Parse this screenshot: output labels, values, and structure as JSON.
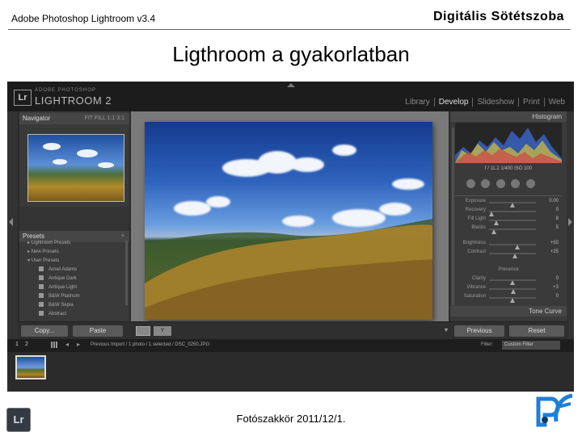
{
  "slide": {
    "header_left": "Adobe Photoshop Lightroom v3.4",
    "header_right": "Digitális Sötétszoba",
    "title": "Ligthroom a gyakorlatban",
    "footer": "Fotószakkör 2011/12/1.",
    "badge": "Lr",
    "logo_icon": "camera-club-logo-icon"
  },
  "lightroom": {
    "logo_mark": "Lr",
    "product_top": "ADOBE PHOTOSHOP",
    "product_name": "LIGHTROOM 2",
    "modules": [
      "Library",
      "Develop",
      "Slideshow",
      "Print",
      "Web"
    ],
    "active_module": "Develop",
    "left_panel": {
      "navigator": "Navigator",
      "navigator_options": "FIT  FILL  1:1  3:1",
      "presets": "Presets",
      "preset_groups": [
        "Lightroom Presets",
        "New Presets",
        "User Presets"
      ],
      "preset_items": [
        "Ansel Adams",
        "Antique Dark",
        "Antique Light",
        "B&W Platinum",
        "B&W Sepia",
        "Abstract"
      ]
    },
    "right_panel": {
      "histogram": "Histogram",
      "readout": "f / 11.2   1/400   ISO 100",
      "sliders": [
        {
          "label": "Exposure",
          "value": "0.00",
          "level": 0.5
        },
        {
          "label": "Recovery",
          "value": "0",
          "level": 0.05
        },
        {
          "label": "Fill Light",
          "value": "8",
          "level": 0.15
        },
        {
          "label": "Blacks",
          "value": "5",
          "level": 0.1
        },
        {
          "label": "Brightness",
          "value": "+50",
          "level": 0.6
        },
        {
          "label": "Contrast",
          "value": "+25",
          "level": 0.55
        },
        {
          "label": "Clarity",
          "value": "0",
          "level": 0.5
        },
        {
          "label": "Vibrance",
          "value": "+3",
          "level": 0.52
        },
        {
          "label": "Saturation",
          "value": "0",
          "level": 0.5
        }
      ],
      "presence": "Presence",
      "tone_curve": "Tone Curve"
    },
    "toolbar": {
      "copy": "Copy...",
      "paste": "Paste",
      "previous": "Previous",
      "reset": "Reset",
      "rating": "Y"
    },
    "filmstrip_bar": {
      "num1": "1",
      "num2": "2",
      "crumb": "Previous Import / 1 photo / 1 selected / DSC_0250.JPG",
      "filter_label": "Filter:",
      "filter_value": "Custom Filter"
    }
  }
}
